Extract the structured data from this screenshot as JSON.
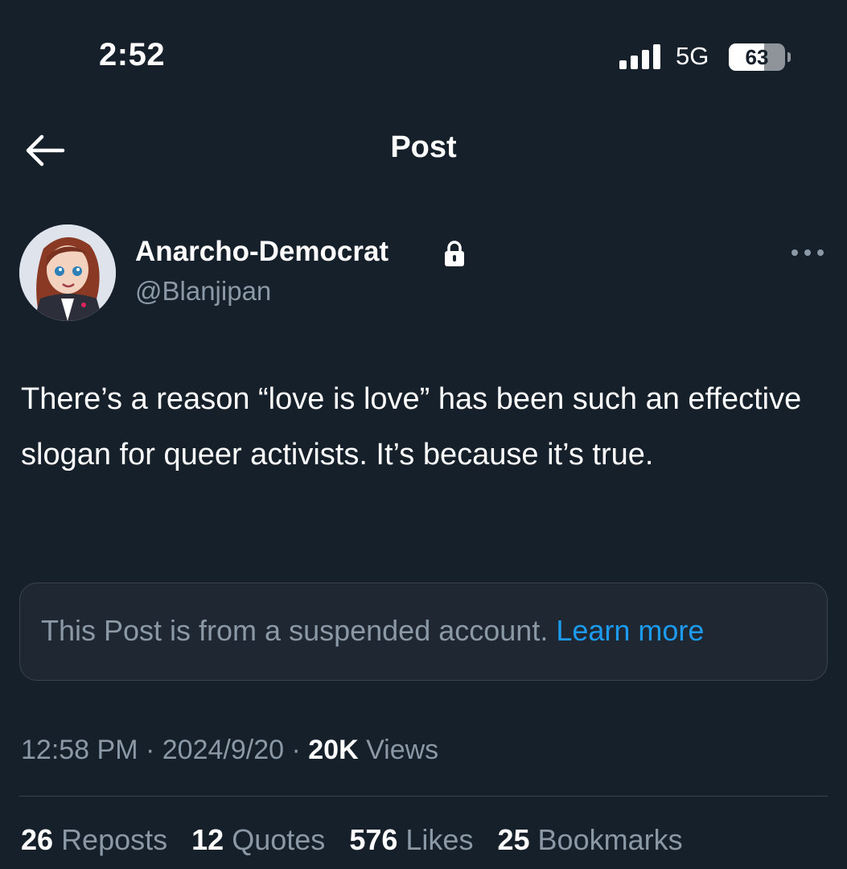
{
  "status_bar": {
    "time": "2:52",
    "network": "5G",
    "battery_level": "63",
    "battery_fraction": 0.63
  },
  "nav": {
    "title": "Post",
    "back_icon": "arrow-left-icon"
  },
  "author": {
    "display_name": "Anarcho-Democrat",
    "handle": "@Blanjipan",
    "protected_icon": "lock-icon"
  },
  "post": {
    "text": "There’s a reason “love is love” has been such an effective slogan for queer activists. It’s because it’s true."
  },
  "notice": {
    "text": "This Post is from a suspended account.",
    "link": "Learn more"
  },
  "meta": {
    "time": "12:58 PM",
    "separator": "·",
    "date": "2024/9/20",
    "views_count": "20K",
    "views_label": "Views"
  },
  "stats": [
    {
      "count": "26",
      "label": "Reposts"
    },
    {
      "count": "12",
      "label": "Quotes"
    },
    {
      "count": "576",
      "label": "Likes"
    },
    {
      "count": "25",
      "label": "Bookmarks"
    }
  ],
  "colors": {
    "background": "#15202b",
    "secondary_text": "#8b98a5",
    "link": "#1d9bf0",
    "border": "#38444d"
  }
}
